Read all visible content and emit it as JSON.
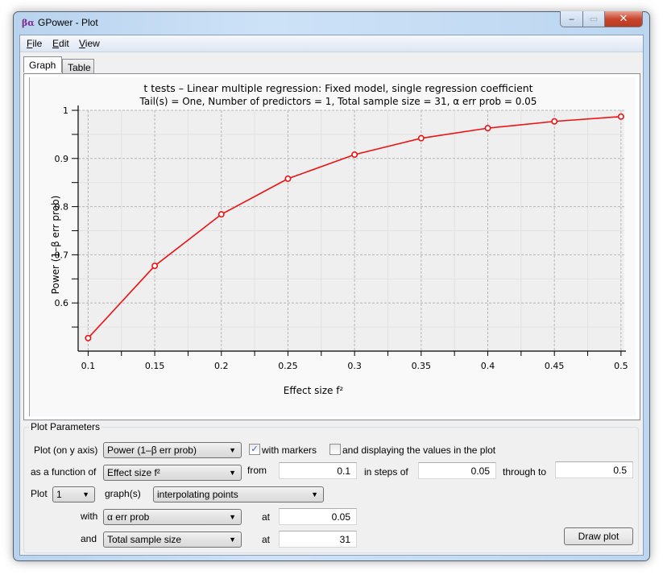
{
  "window": {
    "title": "GPower - Plot",
    "icon": "βα",
    "controls": {
      "minimize": "‒",
      "maximize": "▭",
      "close": "✕"
    }
  },
  "menu": [
    {
      "label_u": "F",
      "label_rest": "ile"
    },
    {
      "label_u": "E",
      "label_rest": "dit"
    },
    {
      "label_u": "V",
      "label_rest": "iew"
    }
  ],
  "tabs": [
    {
      "label": "Graph",
      "active": true
    },
    {
      "label": "Table",
      "active": false
    }
  ],
  "chart_data": {
    "type": "line",
    "title": "t tests – Linear multiple regression: Fixed model, single regression coefficient",
    "subtitle": "Tail(s) = One, Number of predictors = 1, Total sample size = 31, α err prob = 0.05",
    "xlabel": "Effect size f²",
    "ylabel": "Power (1–β err prob)",
    "x": [
      0.1,
      0.15,
      0.2,
      0.25,
      0.3,
      0.35,
      0.4,
      0.45,
      0.5
    ],
    "series": [
      {
        "name": "Power",
        "color": "#ee1111",
        "markers": true,
        "values": [
          0.527,
          0.677,
          0.784,
          0.858,
          0.908,
          0.942,
          0.963,
          0.977,
          0.987
        ]
      }
    ],
    "xlim": [
      0.0925,
      0.5025
    ],
    "ylim": [
      0.5,
      1.0
    ],
    "xticks": [
      "0.1",
      "0.15",
      "0.2",
      "0.25",
      "0.3",
      "0.35",
      "0.4",
      "0.45",
      "0.5"
    ],
    "xtick_values": [
      0.1,
      0.15,
      0.2,
      0.25,
      0.3,
      0.35,
      0.4,
      0.45,
      0.5
    ],
    "yticks": [
      "0.6",
      "0.7",
      "0.8",
      "0.9",
      "1"
    ],
    "ytick_values": [
      0.6,
      0.7,
      0.8,
      0.9,
      1.0
    ],
    "grid": true
  },
  "params": {
    "group_title": "Plot Parameters",
    "y_axis_label": "Plot (on y axis)",
    "y_axis_value": "Power (1–β err prob)",
    "with_markers_label": "with markers",
    "with_markers_checked": true,
    "display_values_label": "and displaying the values in the plot",
    "display_values_checked": false,
    "function_label": "as a function of",
    "function_value": "Effect size f²",
    "from_label": "from",
    "from_value": "0.1",
    "steps_label": "in steps of",
    "steps_value": "0.05",
    "through_label": "through to",
    "through_value": "0.5",
    "plot_label": "Plot",
    "plot_count": "1",
    "graphs_label": "graph(s)",
    "graph_mode": "interpolating points",
    "with_label": "with",
    "with_value": "α err prob",
    "at1_label": "at",
    "at1_value": "0.05",
    "and_label": "and",
    "and_value": "Total sample size",
    "at2_label": "at",
    "at2_value": "31",
    "draw_button": "Draw plot",
    "check_mark": "✓",
    "dropdown_arrow": "▼"
  }
}
